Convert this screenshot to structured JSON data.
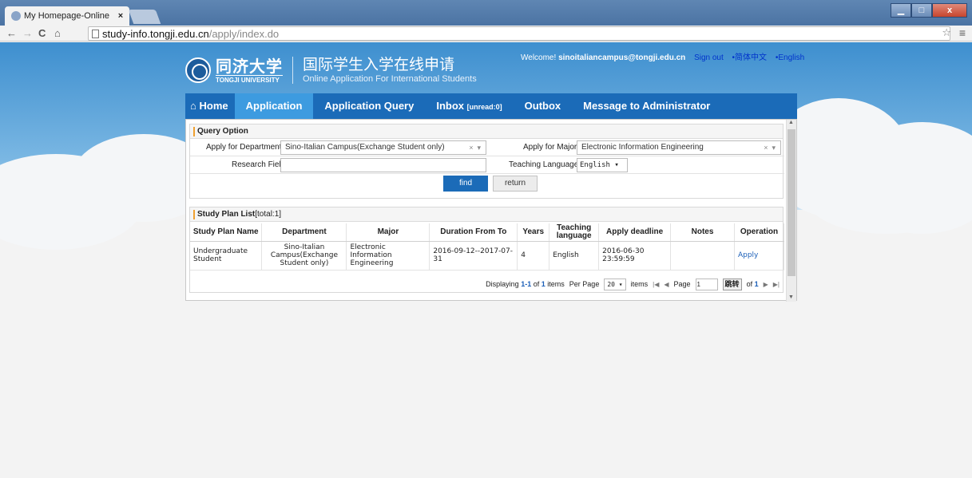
{
  "browser": {
    "tab_title": "My Homepage-Online",
    "tab_close": "×",
    "url_host": "study-info.tongji.edu.cn",
    "url_path": "/apply/index.do",
    "window_buttons": {
      "minimize": "▁",
      "maximize": "□",
      "close": "x"
    }
  },
  "header": {
    "logo_cn": "同济大学",
    "logo_en": "TONGJI UNIVERSITY",
    "system_cn": "国际学生入学在线申请",
    "system_en": "Online Application For International Students",
    "welcome_prefix": "Welcome!",
    "user_email": "sinoitaliancampus@tongji.edu.cn",
    "sign_out": "Sign out",
    "lang_cn": "•简体中文",
    "lang_en": "•English"
  },
  "nav": {
    "home": "Home",
    "application": "Application",
    "application_query": "Application Query",
    "inbox": "Inbox",
    "inbox_unread": "[unread:0]",
    "outbox": "Outbox",
    "message_admin": "Message to Administrator"
  },
  "query": {
    "title": "Query Option",
    "dept_label": "Apply for Department",
    "dept_value": "Sino-Italian Campus(Exchange Student only)",
    "major_label": "Apply for Major",
    "major_value": "Electronic Information Engineering",
    "research_label": "Research Field",
    "research_value": "",
    "lang_label": "Teaching Language",
    "lang_value": "English",
    "find": "find",
    "return": "return"
  },
  "list": {
    "title": "Study Plan List",
    "total": "[total:1]",
    "columns": [
      "Study Plan Name",
      "Department",
      "Major",
      "Duration From To",
      "Years",
      "Teaching language",
      "Apply deadline",
      "Notes",
      "Operation"
    ],
    "rows": [
      {
        "name": "Undergraduate Student",
        "department": "Sino-Italian Campus(Exchange Student only)",
        "major": "Electronic Information Engineering",
        "duration": "2016-09-12--2017-07-31",
        "years": "4",
        "teaching_language": "English",
        "deadline": "2016-06-30 23:59:59",
        "notes": "",
        "operation": "Apply"
      }
    ]
  },
  "pager": {
    "displaying": "Displaying",
    "range": "1-1",
    "of": "of",
    "count": "1",
    "items": "items",
    "per_page": "Per Page",
    "per_page_value": "20",
    "items2": "items",
    "page_label": "Page",
    "page_value": "1",
    "go": "跳转",
    "of2": "of",
    "total_pages": "1"
  }
}
